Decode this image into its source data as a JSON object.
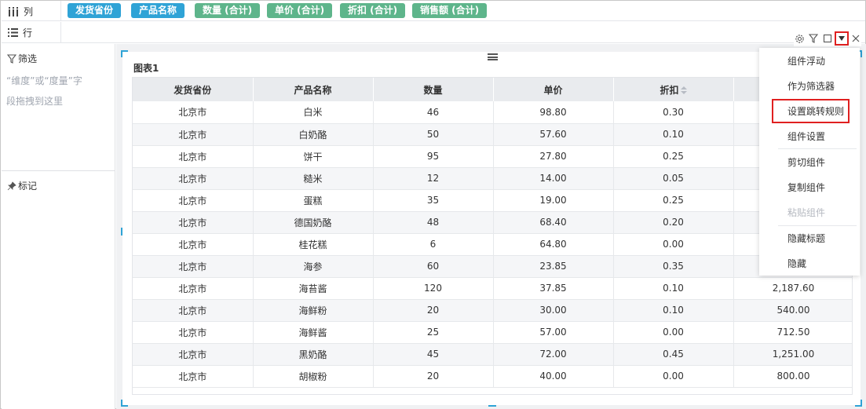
{
  "columns_shelf": {
    "label": "列",
    "pills": [
      {
        "label": "发货省份",
        "kind": "dim"
      },
      {
        "label": "产品名称",
        "kind": "dim"
      },
      {
        "label": "数量 (合计)",
        "kind": "mea"
      },
      {
        "label": "单价 (合计)",
        "kind": "mea"
      },
      {
        "label": "折扣 (合计)",
        "kind": "mea"
      },
      {
        "label": "销售额 (合计)",
        "kind": "mea"
      }
    ]
  },
  "rows_shelf": {
    "label": "行"
  },
  "left_panel": {
    "filter_title": "筛选",
    "filter_hint_line1": "“维度”或“度量”字",
    "filter_hint_line2": "段拖拽到这里",
    "marks_title": "标记"
  },
  "widget": {
    "title": "图表1",
    "table": {
      "headers": [
        "发货省份",
        "产品名称",
        "数量",
        "单价",
        "折扣",
        ""
      ],
      "rows": [
        [
          "北京市",
          "白米",
          "46",
          "98.80",
          "0.30",
          ""
        ],
        [
          "北京市",
          "白奶酪",
          "50",
          "57.60",
          "0.10",
          ""
        ],
        [
          "北京市",
          "饼干",
          "95",
          "27.80",
          "0.25",
          ""
        ],
        [
          "北京市",
          "糙米",
          "12",
          "14.00",
          "0.05",
          ""
        ],
        [
          "北京市",
          "蛋糕",
          "35",
          "19.00",
          "0.25",
          ""
        ],
        [
          "北京市",
          "德国奶酪",
          "48",
          "68.40",
          "0.20",
          ""
        ],
        [
          "北京市",
          "桂花糕",
          "6",
          "64.80",
          "0.00",
          ""
        ],
        [
          "北京市",
          "海参",
          "60",
          "23.85",
          "0.35",
          ""
        ],
        [
          "北京市",
          "海苔酱",
          "120",
          "37.85",
          "0.10",
          "2,187.60"
        ],
        [
          "北京市",
          "海鲜粉",
          "20",
          "30.00",
          "0.10",
          "540.00"
        ],
        [
          "北京市",
          "海鲜酱",
          "25",
          "57.00",
          "0.00",
          "712.50"
        ],
        [
          "北京市",
          "黑奶酪",
          "45",
          "72.00",
          "0.45",
          "1,251.00"
        ],
        [
          "北京市",
          "胡椒粉",
          "20",
          "40.00",
          "0.00",
          "800.00"
        ]
      ]
    }
  },
  "menu": {
    "items": [
      {
        "label": "组件浮动",
        "disabled": false
      },
      {
        "label": "作为筛选器",
        "disabled": false
      },
      {
        "label": "设置跳转规则",
        "disabled": false
      },
      {
        "label": "组件设置",
        "disabled": false
      },
      {
        "label": "剪切组件",
        "disabled": false
      },
      {
        "label": "复制组件",
        "disabled": false
      },
      {
        "label": "粘贴组件",
        "disabled": true
      },
      {
        "label": "隐藏标题",
        "disabled": false
      },
      {
        "label": "隐藏",
        "disabled": false
      }
    ]
  },
  "colors": {
    "dimension_pill": "#2fa3d6",
    "measure_pill": "#5eb58b",
    "highlight_outline": "#e02020",
    "handle": "#2fa3d6"
  },
  "icons": {
    "columns": "column-bars-icon",
    "rows": "row-list-icon",
    "filter": "filter-icon",
    "marks": "pin-icon",
    "toolbar": [
      "gear-icon",
      "filter-icon",
      "maximize-icon",
      "dropdown-triangle-icon",
      "close-icon"
    ]
  }
}
